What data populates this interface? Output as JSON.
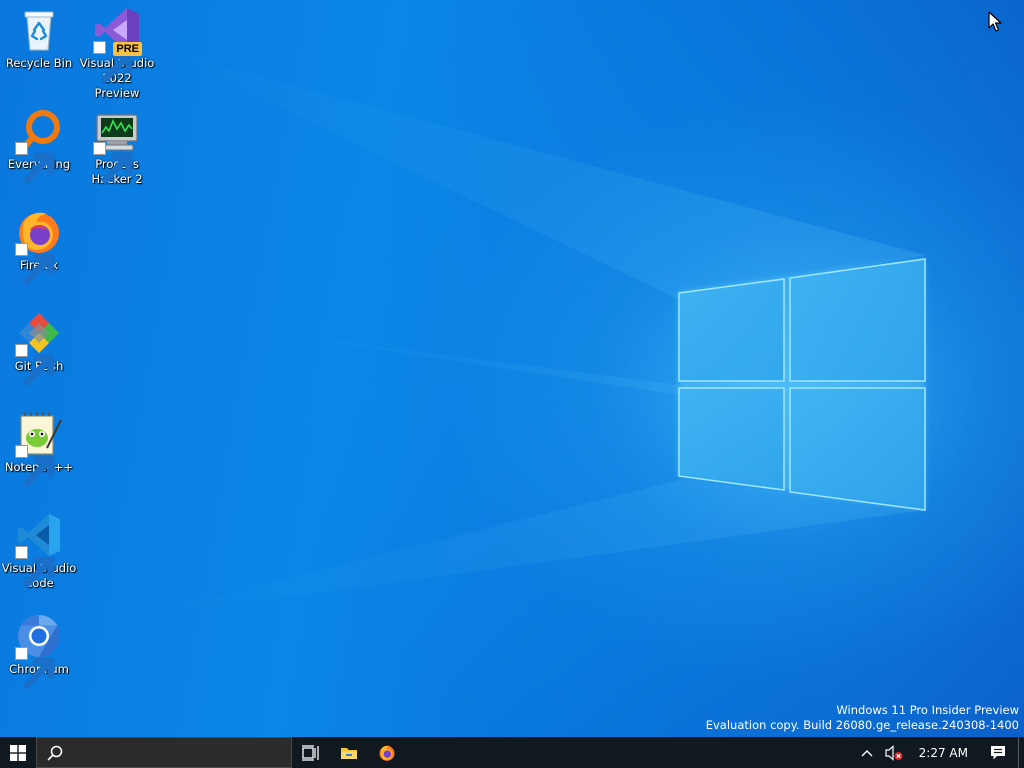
{
  "desktop": {
    "icons": [
      {
        "label": "Recycle Bin",
        "icon": "recycle-bin-icon",
        "shortcut": false
      },
      {
        "label": "Visual Studio\n2022 Preview",
        "icon": "visual-studio-preview-icon",
        "badge": "PRE",
        "shortcut": true
      },
      {
        "label": "Everything",
        "icon": "everything-search-icon",
        "shortcut": true
      },
      {
        "label": "Process\nHacker 2",
        "icon": "process-hacker-icon",
        "shortcut": true
      },
      {
        "label": "Firefox",
        "icon": "firefox-icon",
        "shortcut": true
      },
      {
        "label": "Git Bash",
        "icon": "git-bash-icon",
        "shortcut": true
      },
      {
        "label": "Notepad++",
        "icon": "notepad-plus-plus-icon",
        "shortcut": true
      },
      {
        "label": "Visual Studio\nCode",
        "icon": "vscode-icon",
        "shortcut": true
      },
      {
        "label": "Chromium",
        "icon": "chromium-icon",
        "shortcut": true
      }
    ],
    "watermark": {
      "line1": "Windows 11 Pro Insider Preview",
      "line2": "Evaluation copy. Build 26080.ge_release.240308-1400"
    }
  },
  "taskbar": {
    "start": "windows-start-icon",
    "search": {
      "value": "",
      "placeholder": ""
    },
    "pinned": [
      "task-view-icon",
      "file-explorer-icon",
      "firefox-icon"
    ],
    "tray": {
      "overflow": "chevron-up-icon",
      "volume": "volume-muted-icon",
      "clock": "2:27 AM",
      "notifications": "action-center-icon"
    }
  },
  "colors": {
    "desktop_accent": "#0a78de",
    "taskbar": "#101820",
    "search_box": "#2b2b2b",
    "logo_glow": "#5fd0ff"
  }
}
